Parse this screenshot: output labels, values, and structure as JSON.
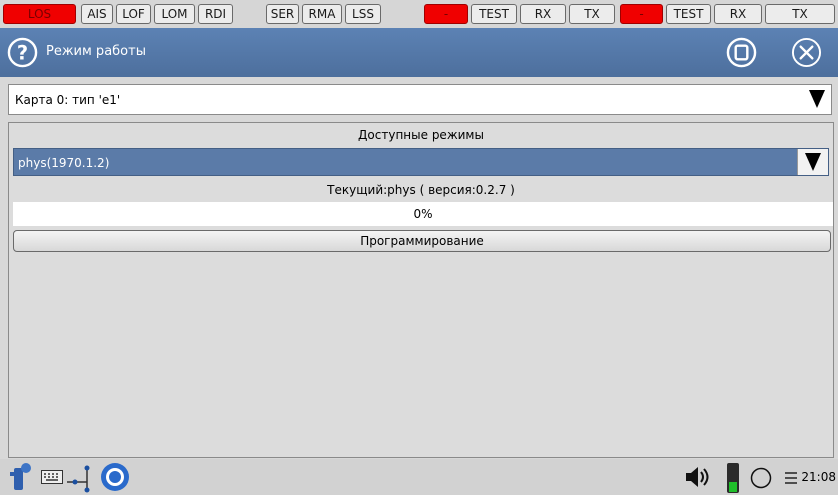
{
  "status_bar": {
    "items": [
      {
        "label": "LOS",
        "alarm": true
      },
      {
        "label": "AIS",
        "alarm": false
      },
      {
        "label": "LOF",
        "alarm": false
      },
      {
        "label": "LOM",
        "alarm": false
      },
      {
        "label": "RDI",
        "alarm": false
      },
      {
        "label": "SER",
        "alarm": false
      },
      {
        "label": "RMA",
        "alarm": false
      },
      {
        "label": "LSS",
        "alarm": false
      },
      {
        "label": "-",
        "alarm": true
      },
      {
        "label": "TEST",
        "alarm": false
      },
      {
        "label": "RX",
        "alarm": false
      },
      {
        "label": "TX",
        "alarm": false
      },
      {
        "label": "-",
        "alarm": true
      },
      {
        "label": "TEST",
        "alarm": false
      },
      {
        "label": "RX",
        "alarm": false
      },
      {
        "label": "TX",
        "alarm": false
      }
    ],
    "alarm_color": "#f00000"
  },
  "header": {
    "title": "Режим работы",
    "help_icon": "help-icon",
    "stop_icon": "stop-icon",
    "close_icon": "close-icon"
  },
  "card_select": {
    "value": "Карта 0: тип 'e1'"
  },
  "modes": {
    "label": "Доступные режимы",
    "selected": "phys(1970.1.2)",
    "current": "Текущий:phys ( версия:0.2.7 )",
    "progress_text": "0%",
    "progress": 0,
    "program_button": "Программирование"
  },
  "taskbar": {
    "clock": "21:08",
    "icons": [
      "app-icon",
      "keyboard-icon",
      "network-icon",
      "browser-icon",
      "volume-icon",
      "battery-icon",
      "circle-icon",
      "menu-icon"
    ]
  },
  "colors": {
    "accent": "#5b7ba8",
    "alarm": "#f00000"
  }
}
